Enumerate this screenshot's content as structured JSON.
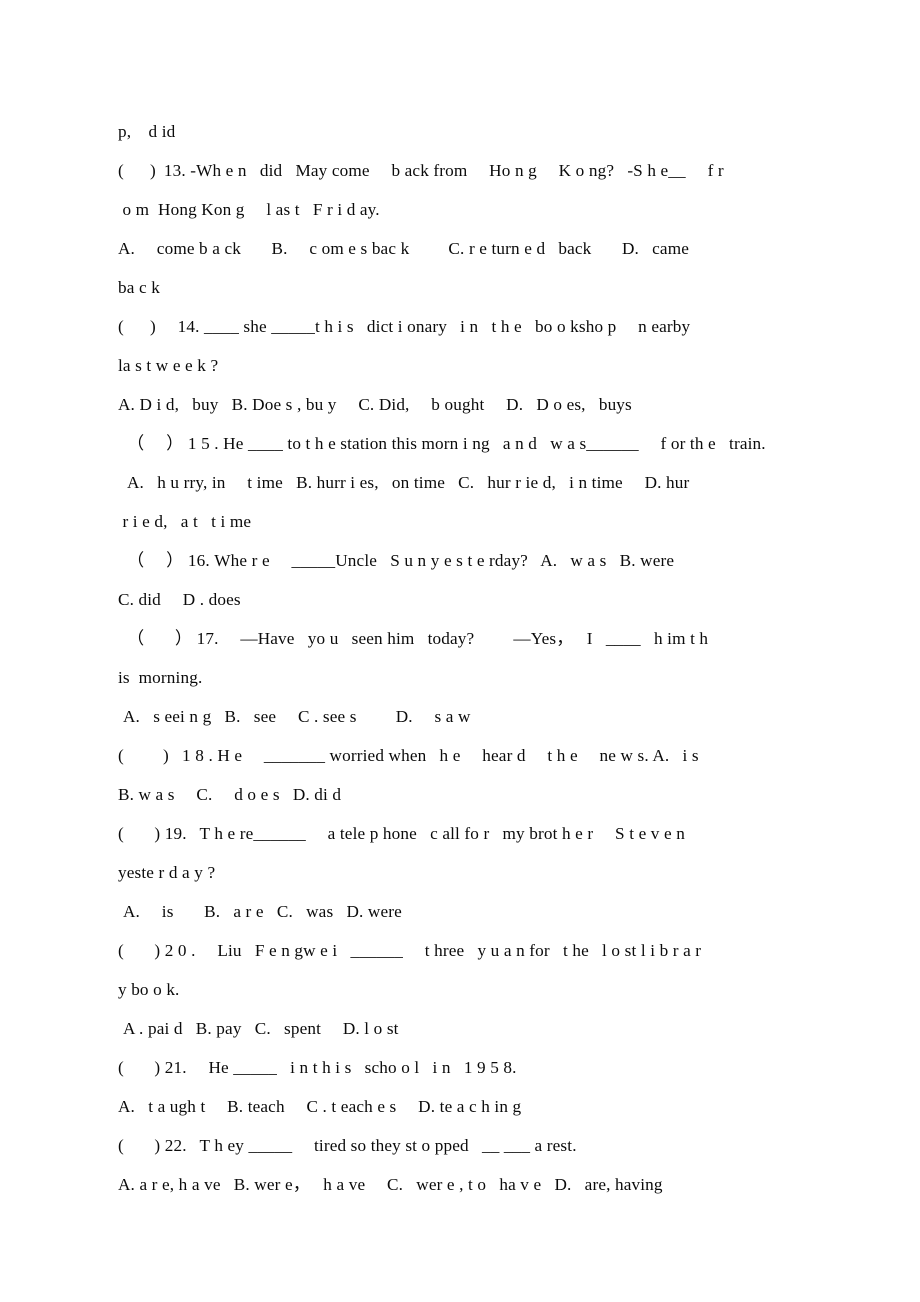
{
  "document": {
    "type": "scanned-worksheet",
    "subject": "English grammar multiple choice exercise",
    "page_background": "#ffffff",
    "text_color": "#0b0b0b",
    "lines": [
      {
        "id": "l01",
        "text": "p, d id",
        "indent": "none"
      },
      {
        "id": "l02",
        "text": "(  )  13. -Wh e n  did  May come  b ack from  Ho n g  K o ng?  -S h e__  f r",
        "indent": "none"
      },
      {
        "id": "l03",
        "text": " o m  Hong Kon g  l as t  F r i d ay.",
        "indent": "none"
      },
      {
        "id": "l04",
        "text": "A.  come b a ck   B.  c om e s bac k   C. r e turn e d  back   D.  came",
        "indent": "none"
      },
      {
        "id": "l05",
        "text": "ba c k",
        "indent": "none"
      },
      {
        "id": "l06",
        "text": "(  )  14. ____ she _____t h i s  dict i onary  i n  t h e  bo o ksho p  n earby",
        "indent": "none"
      },
      {
        "id": "l07",
        "text": "la s t w e e k ?",
        "indent": "none"
      },
      {
        "id": "l08",
        "text": "A. D i d,  buy  B. Doe s , bu y  C. Did,  b ought  D.  D o es,  buys",
        "indent": "none"
      },
      {
        "id": "l09",
        "text": "（  ） 1 5 . He ____ to t h e station this morn i ng  a n d  w a s______  f or th e  train.",
        "indent": "small"
      },
      {
        "id": "l10",
        "text": "A.  h u rry, in  t ime  B. hurr i es,  on time  C.  hur r ie d,  i n time  D. hur",
        "indent": "small"
      },
      {
        "id": "l11",
        "text": " r i e d,  a t  t i me",
        "indent": "none"
      },
      {
        "id": "l12",
        "text": "（  ） 16. Whe r e  _____Uncle  S u n y e s t e rday?  A.  w a s  B. were",
        "indent": "small"
      },
      {
        "id": "l13",
        "text": "C. did  D . does",
        "indent": "none"
      },
      {
        "id": "l14",
        "text": "（   ） 17.  —Have  yo u  seen him  today?   —Yes，  I  ____  h im t h",
        "indent": "small"
      },
      {
        "id": "l15",
        "text": "is  morning.",
        "indent": "none"
      },
      {
        "id": "l16",
        "text": "A.  s eei n g  B.  see  C . see s   D.  s a w",
        "indent": "small2"
      },
      {
        "id": "l17",
        "text": "(   )  1 8 . H e  _______ worried when  h e  hear d  t h e  ne w s. A.  i s",
        "indent": "none"
      },
      {
        "id": "l18",
        "text": "B. w a s  C.  d o e s  D. di d",
        "indent": "none"
      },
      {
        "id": "l19",
        "text": "(   ) 19.  T h e re______  a tele p hone  c all fo r  my brot h e r  S t e v e n",
        "indent": "none"
      },
      {
        "id": "l20",
        "text": "yeste r d a y ?",
        "indent": "none"
      },
      {
        "id": "l21",
        "text": "A.  is   B.  a r e  C.  was  D. were",
        "indent": "small2"
      },
      {
        "id": "l22",
        "text": "(   ) 2 0 .  Liu  F e n gw e i  ______  t hree  y u a n for  t he  l o st l i b r a r",
        "indent": "none"
      },
      {
        "id": "l23",
        "text": "y bo o k.",
        "indent": "none"
      },
      {
        "id": "l24",
        "text": "A . pai d  B. pay  C.  spent  D. l o st",
        "indent": "small2"
      },
      {
        "id": "l25",
        "text": "(   ) 21.  He _____  i n t h i s  scho o l  i n  1 9 5 8.",
        "indent": "none"
      },
      {
        "id": "l26",
        "text": "A.  t a ugh t  B. teach  C . t each e s  D. te a c h in g",
        "indent": "none"
      },
      {
        "id": "l27",
        "text": "(   ) 22.  T h ey _____  tired so they st o pped  __ ___ a rest.",
        "indent": "none"
      },
      {
        "id": "l28",
        "text": "A. a r e, h a ve  B. wer e，  h a ve  C.  wer e , t o  ha v e  D.  are, having",
        "indent": "none"
      }
    ]
  }
}
